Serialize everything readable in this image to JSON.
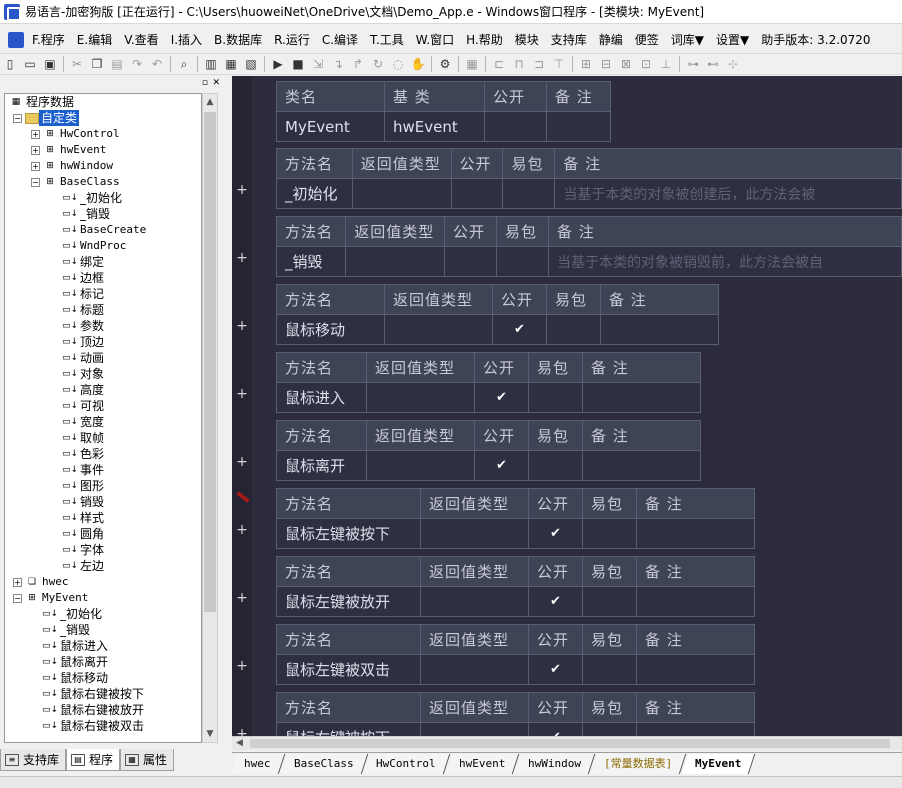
{
  "window": {
    "title": "易语言-加密狗版 [正在运行] - C:\\Users\\huoweiNet\\OneDrive\\文档\\Demo_App.e - Windows窗口程序 - [类模块: MyEvent]"
  },
  "menu": [
    "F.程序",
    "E.编辑",
    "V.查看",
    "I.插入",
    "B.数据库",
    "R.运行",
    "C.编译",
    "T.工具",
    "W.窗口",
    "H.帮助",
    "模块",
    "支持库",
    "静编",
    "便签",
    "词库▼",
    "设置▼",
    "助手版本: 3.2.0720"
  ],
  "tree": {
    "header": "程序数据",
    "items": [
      {
        "level": 1,
        "exp": "-",
        "icon": "folder",
        "label": "自定类",
        "selected": true
      },
      {
        "level": 2,
        "exp": "+",
        "icon": "cls",
        "label": "HwControl"
      },
      {
        "level": 2,
        "exp": "+",
        "icon": "cls",
        "label": "hwEvent"
      },
      {
        "level": 2,
        "exp": "+",
        "icon": "cls",
        "label": "hwWindow"
      },
      {
        "level": 2,
        "exp": "-",
        "icon": "cls",
        "label": "BaseClass"
      },
      {
        "level": 3,
        "icon": "m",
        "label": "_初始化"
      },
      {
        "level": 3,
        "icon": "m",
        "label": "_销毁"
      },
      {
        "level": 3,
        "icon": "m",
        "label": "BaseCreate"
      },
      {
        "level": 3,
        "icon": "m",
        "label": "WndProc"
      },
      {
        "level": 3,
        "icon": "m",
        "label": "绑定"
      },
      {
        "level": 3,
        "icon": "m",
        "label": "边框"
      },
      {
        "level": 3,
        "icon": "m",
        "label": "标记"
      },
      {
        "level": 3,
        "icon": "m",
        "label": "标题"
      },
      {
        "level": 3,
        "icon": "m",
        "label": "参数"
      },
      {
        "level": 3,
        "icon": "m",
        "label": "顶边"
      },
      {
        "level": 3,
        "icon": "m",
        "label": "动画"
      },
      {
        "level": 3,
        "icon": "m",
        "label": "对象"
      },
      {
        "level": 3,
        "icon": "m",
        "label": "高度"
      },
      {
        "level": 3,
        "icon": "m",
        "label": "可视"
      },
      {
        "level": 3,
        "icon": "m",
        "label": "宽度"
      },
      {
        "level": 3,
        "icon": "m",
        "label": "取帧"
      },
      {
        "level": 3,
        "icon": "m",
        "label": "色彩"
      },
      {
        "level": 3,
        "icon": "m",
        "label": "事件"
      },
      {
        "level": 3,
        "icon": "m",
        "label": "图形"
      },
      {
        "level": 3,
        "icon": "m",
        "label": "销毁"
      },
      {
        "level": 3,
        "icon": "m",
        "label": "样式"
      },
      {
        "level": 3,
        "icon": "m",
        "label": "圆角"
      },
      {
        "level": 3,
        "icon": "m",
        "label": "字体"
      },
      {
        "level": 3,
        "icon": "m",
        "label": "左边"
      },
      {
        "level": 1,
        "exp": "+",
        "icon": "mod",
        "label": "hwec"
      },
      {
        "level": 1,
        "exp": "-",
        "icon": "cls",
        "label": "MyEvent"
      },
      {
        "level": 2,
        "icon": "m",
        "label": "_初始化"
      },
      {
        "level": 2,
        "icon": "m",
        "label": "_销毁"
      },
      {
        "level": 2,
        "icon": "m",
        "label": "鼠标进入"
      },
      {
        "level": 2,
        "icon": "m",
        "label": "鼠标离开"
      },
      {
        "level": 2,
        "icon": "m",
        "label": "鼠标移动"
      },
      {
        "level": 2,
        "icon": "m",
        "label": "鼠标右键被按下"
      },
      {
        "level": 2,
        "icon": "m",
        "label": "鼠标右键被放开"
      },
      {
        "level": 2,
        "icon": "m",
        "label": "鼠标右键被双击"
      }
    ]
  },
  "left_tabs": [
    "支持库",
    "程序",
    "属性"
  ],
  "class_table": {
    "headers": [
      "类名",
      "基 类",
      "公开",
      "备 注"
    ],
    "row": [
      "MyEvent",
      "hwEvent",
      "",
      ""
    ]
  },
  "method_headers": [
    "方法名",
    "返回值类型",
    "公开",
    "易包",
    "备 注"
  ],
  "methods": [
    {
      "name": "_初始化",
      "ret": "",
      "public": false,
      "easy": "",
      "note": "当基于本类的对象被创建后，此方法会被"
    },
    {
      "name": "_销毁",
      "ret": "",
      "public": false,
      "easy": "",
      "note": "当基于本类的对象被销毁前，此方法会被自"
    },
    {
      "name": "鼠标移动",
      "ret": "",
      "public": true,
      "easy": "",
      "note": ""
    },
    {
      "name": "鼠标进入",
      "ret": "",
      "public": true,
      "easy": "",
      "note": ""
    },
    {
      "name": "鼠标离开",
      "ret": "",
      "public": true,
      "easy": "",
      "note": ""
    },
    {
      "name": "鼠标左键被按下",
      "ret": "",
      "public": true,
      "easy": "",
      "note": ""
    },
    {
      "name": "鼠标左键被放开",
      "ret": "",
      "public": true,
      "easy": "",
      "note": ""
    },
    {
      "name": "鼠标左键被双击",
      "ret": "",
      "public": true,
      "easy": "",
      "note": ""
    },
    {
      "name": "鼠标右键被按下",
      "ret": "",
      "public": true,
      "easy": "",
      "note": ""
    }
  ],
  "check_mark": "✔",
  "plus": "+",
  "doc_tabs": [
    {
      "label": "hwec"
    },
    {
      "label": "BaseClass"
    },
    {
      "label": "HwControl"
    },
    {
      "label": "hwEvent"
    },
    {
      "label": "hwWindow"
    },
    {
      "label": "[常量数据表]",
      "gold": true
    },
    {
      "label": "MyEvent",
      "active": true
    }
  ]
}
